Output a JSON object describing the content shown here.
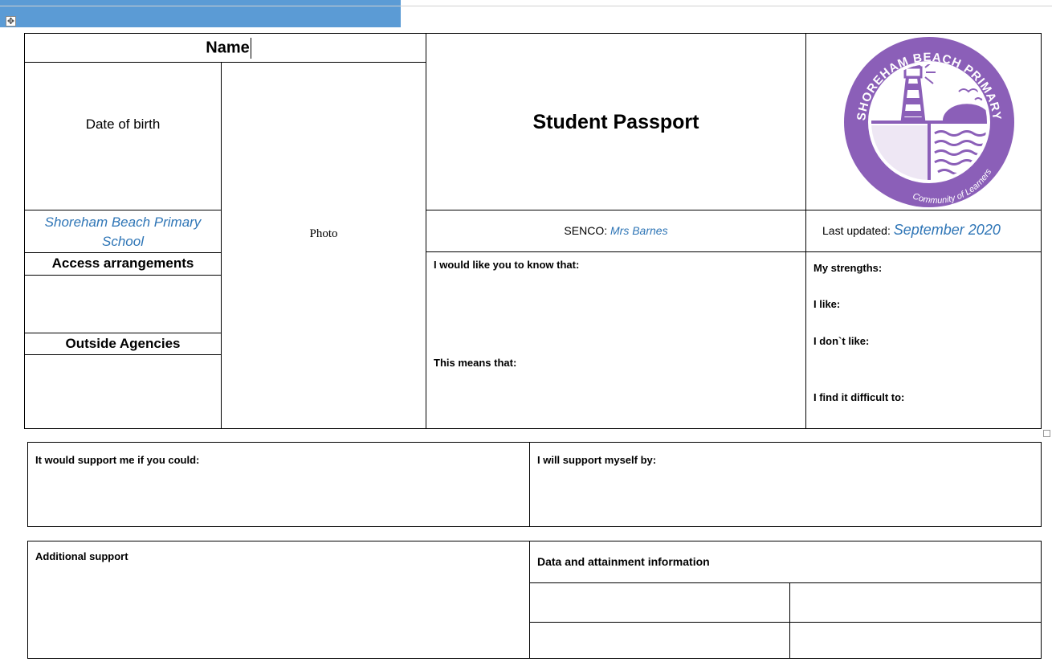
{
  "header": {
    "name_label": "Name",
    "title": "Student Passport"
  },
  "left": {
    "dob_label": "Date of birth",
    "school_name": "Shoreham Beach Primary School",
    "access_label": "Access arrangements",
    "agencies_label": "Outside Agencies",
    "photo_label": "Photo"
  },
  "senco": {
    "label": "SENCO: ",
    "value": "Mrs Barnes"
  },
  "updated": {
    "label": "Last updated: ",
    "value": "September 2020"
  },
  "know": {
    "label": "I would like you to know that:",
    "means_label": "This means that:"
  },
  "strengths": {
    "strengths_label": "My strengths:",
    "like_label": "I like:",
    "dont_like_label": "I don`t like:",
    "difficult_label": "I find it difficult to:"
  },
  "support": {
    "could_label": "It would support me if you could:",
    "myself_label": "I will support myself by:"
  },
  "additional": {
    "additional_label": "Additional support",
    "data_label": "Data and attainment information"
  },
  "logo": {
    "top_text": "SHOREHAM BEACH PRIMARY",
    "bottom_text": "Community of Learners",
    "color": "#8B5FB8"
  },
  "colors": {
    "name_bar": "#5B9BD5",
    "accent_text": "#2E75B6"
  }
}
